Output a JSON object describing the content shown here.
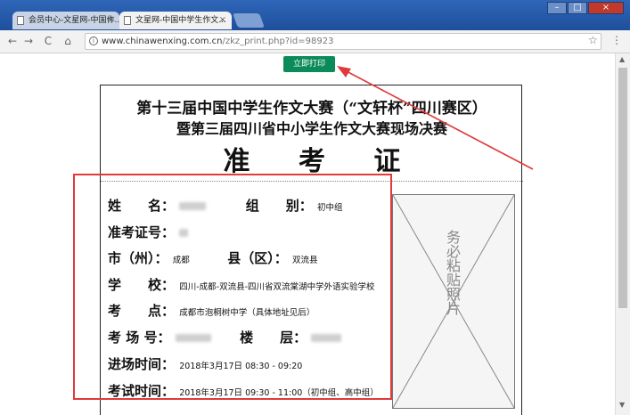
{
  "browser": {
    "tabs": [
      {
        "label": "会员中心-文星网-中国作..."
      },
      {
        "label": "文星网-中国中学生作文..."
      }
    ],
    "address": {
      "host": "www.chinawenxing.com.cn",
      "path": "/zkz_print.php?id=98923"
    },
    "icons": {
      "back": "←",
      "forward": "→",
      "reload": "C",
      "home": "⌂",
      "star": "☆",
      "menu": "⋮"
    }
  },
  "page": {
    "print_button": "立即打印",
    "title_line1": "第十三届中国中学生作文大赛（“文轩杯”四川赛区）",
    "title_line2": "暨第三届四川省中小学生作文大赛现场决赛",
    "title_line3": "准 考 证",
    "fields": {
      "name_label": "姓　　名：",
      "group_label": "组　　别：",
      "group_value": "初中组",
      "exam_no_label": "准考证号：",
      "city_label": "市（州）：",
      "city_value": "成都",
      "county_label": "县（区）：",
      "county_value": "双流县",
      "school_label": "学　　校：",
      "school_value": "四川-成都-双流县-四川省双流棠湖中学外语实验学校",
      "venue_label": "考　　点：",
      "venue_value": "成都市泡桐树中学（具体地址见后）",
      "room_label": "考 场 号：",
      "floor_label": "楼　　层：",
      "entry_time_label": "进场时间：",
      "entry_time_value": "2018年3月17日 08:30 - 09:20",
      "exam_time_label": "考试时间：",
      "exam_time_value": "2018年3月17日 09:30 - 11:00（初中组、高中组）"
    },
    "photo_text": "务必粘贴照片"
  },
  "colors": {
    "print_button": "#0b8b59",
    "annotation": "#e03a3a",
    "chrome": "#2f66b8"
  }
}
